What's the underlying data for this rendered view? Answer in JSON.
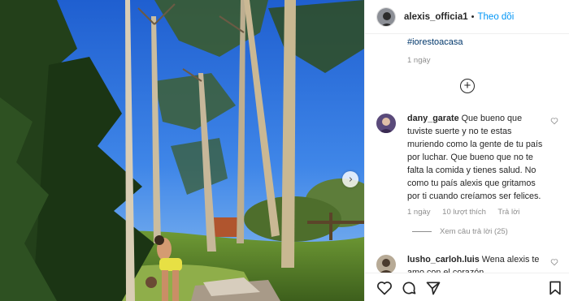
{
  "header": {
    "username": "alexis_officia1",
    "separator": "•",
    "follow_label": "Theo dõi"
  },
  "caption": {
    "hashtag": "#iorestoacasa",
    "time": "1 ngày"
  },
  "comments": [
    {
      "username": "dany_garate",
      "text": "Que bueno que tuviste suerte y no te estas muriendo como la gente de tu país por luchar. Que bueno que no te falta la comida y tienes salud. No como tu país alexis que gritamos por ti cuando creíamos ser felices.",
      "time": "1 ngày",
      "likes": "10 lượt thích",
      "reply_label": "Trả lời",
      "view_replies": "Xem câu trả lời (25)"
    },
    {
      "username": "lusho_carloh.luis",
      "text": "Wena alexis te amo con el corazón"
    }
  ],
  "icons": {
    "carousel_next": "›",
    "add_comment": "+",
    "like": "heart-icon",
    "comment": "comment-icon",
    "share": "share-icon",
    "save": "bookmark-icon"
  },
  "colors": {
    "follow": "#0095f6",
    "secondary_text": "#8e8e8e",
    "hashtag": "#00376b"
  }
}
